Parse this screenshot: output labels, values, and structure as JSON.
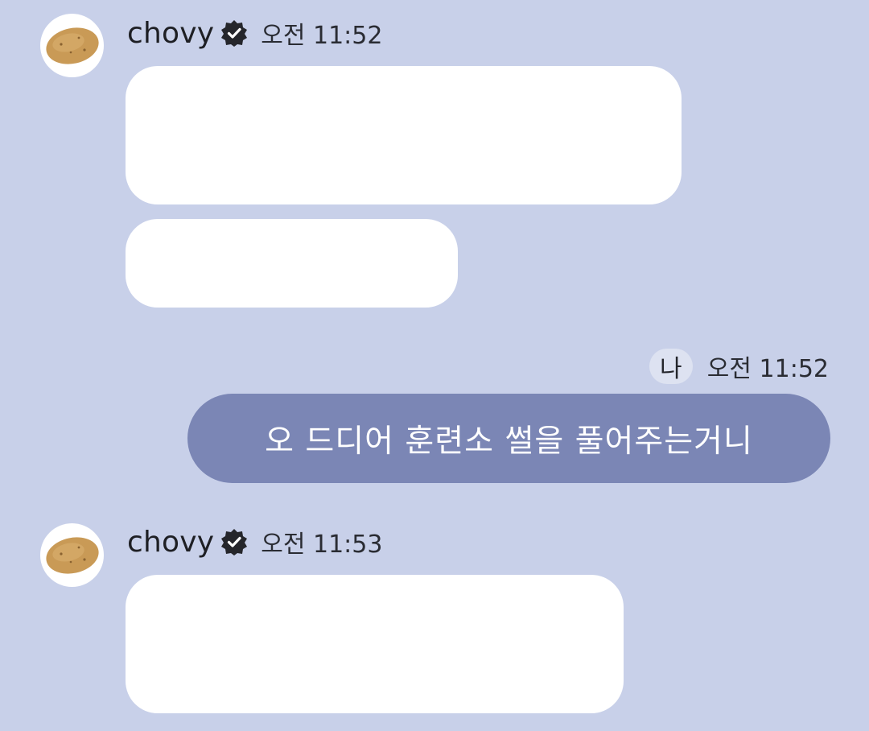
{
  "messages": [
    {
      "sender": "chovy",
      "time": "오전 11:52",
      "avatar_icon": "potato-avatar-icon",
      "verified_icon": "verified-badge-icon",
      "bubbles": [
        "",
        ""
      ]
    },
    {
      "sender_label": "나",
      "time": "오전 11:52",
      "text": "오 드디어 훈련소 썰을 풀어주는거니"
    },
    {
      "sender": "chovy",
      "time": "오전 11:53",
      "avatar_icon": "potato-avatar-icon",
      "verified_icon": "verified-badge-icon",
      "bubbles": [
        ""
      ]
    }
  ],
  "colors": {
    "background": "#c8d0e9",
    "incoming_bubble": "#ffffff",
    "outgoing_bubble": "#7b86b5",
    "me_chip": "#dde2f1"
  }
}
